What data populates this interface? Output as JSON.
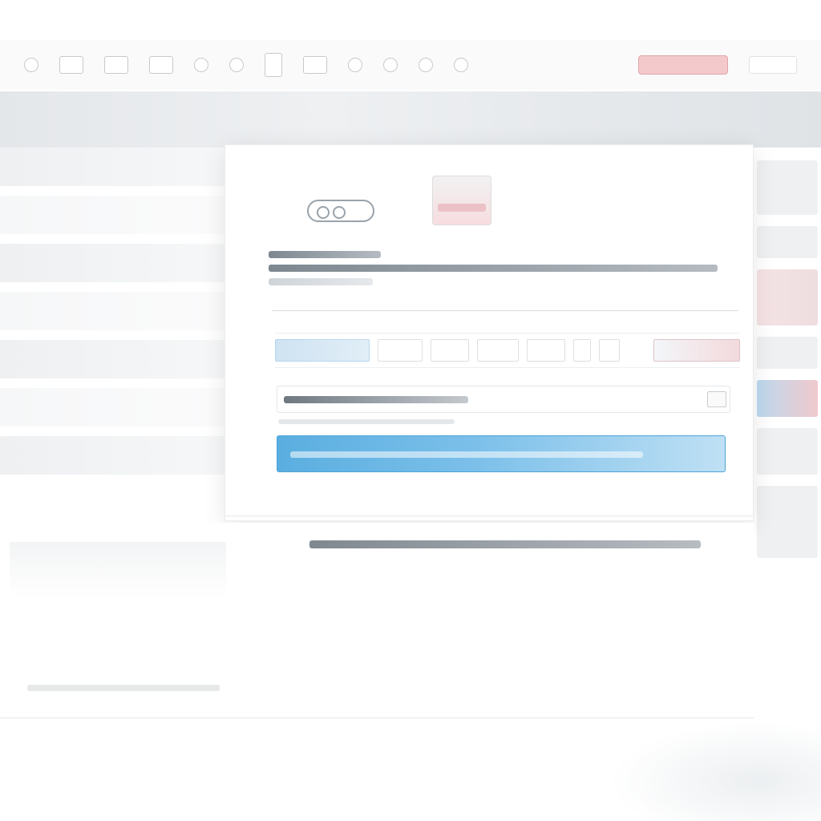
{
  "toolbar": {
    "icons": [
      "back-icon",
      "grid-icon",
      "table-icon",
      "layout-icon",
      "search-icon",
      "info-icon",
      "document-icon",
      "folder-icon",
      "line-icon",
      "circle-icon",
      "square-icon",
      "tag-icon"
    ],
    "primary_label": "",
    "secondary_label": ""
  },
  "modal": {
    "title": "",
    "description": "",
    "tabs": [],
    "field": {
      "value": "",
      "placeholder": ""
    },
    "cta_label": ""
  },
  "footer": {
    "text": ""
  },
  "colors": {
    "accent": "#5aaee0",
    "accent_border": "#4ea3d8",
    "danger_soft": "#f3c9cc",
    "band": "#e4e7ea"
  }
}
